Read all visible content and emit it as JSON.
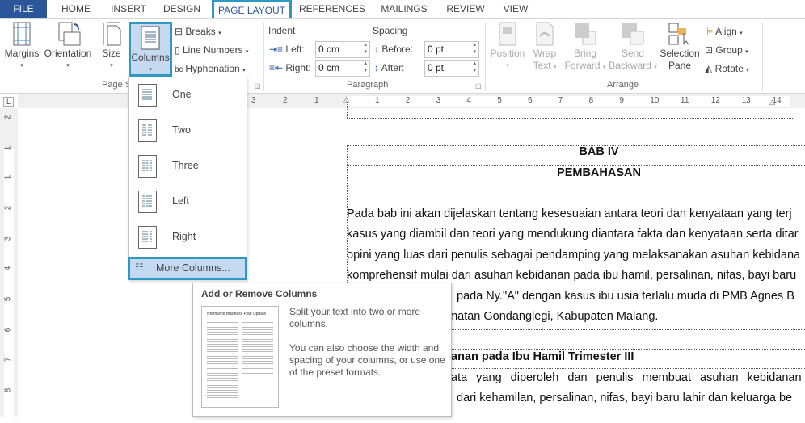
{
  "tabs": [
    {
      "label": "FILE"
    },
    {
      "label": "HOME"
    },
    {
      "label": "INSERT"
    },
    {
      "label": "DESIGN"
    },
    {
      "label": "PAGE LAYOUT",
      "active": true
    },
    {
      "label": "REFERENCES"
    },
    {
      "label": "MAILINGS"
    },
    {
      "label": "REVIEW"
    },
    {
      "label": "VIEW"
    }
  ],
  "ribbon": {
    "page_setup": {
      "group": "Page Setup",
      "margins": "Margins",
      "orientation": "Orientation",
      "size": "Size",
      "columns": "Columns",
      "breaks": "Breaks",
      "line_numbers": "Line Numbers",
      "hyphenation": "Hyphenation"
    },
    "paragraph": {
      "group": "Paragraph",
      "indent": "Indent",
      "spacing": "Spacing",
      "left_label": "Left:",
      "left_value": "0 cm",
      "right_label": "Right:",
      "right_value": "0 cm",
      "before_label": "Before:",
      "before_value": "0 pt",
      "after_label": "After:",
      "after_value": "0 pt"
    },
    "arrange": {
      "group": "Arrange",
      "position": "Position",
      "wrap1": "Wrap",
      "wrap2": "Text",
      "bring1": "Bring",
      "bring2": "Forward",
      "send1": "Send",
      "send2": "Backward",
      "sel1": "Selection",
      "sel2": "Pane",
      "align": "Align",
      "group_btn": "Group",
      "rotate": "Rotate"
    }
  },
  "columns_menu": {
    "items": [
      {
        "label": "One"
      },
      {
        "label": "Two"
      },
      {
        "label": "Three"
      },
      {
        "label": "Left"
      },
      {
        "label": "Right"
      }
    ],
    "more": "More Columns..."
  },
  "tooltip": {
    "title": "Add or Remove Columns",
    "p1": "Split your text into two or more columns.",
    "p2": "You can also choose the width and spacing of your columns, or use one of the preset formats.",
    "thumb_title": "Northwind Business Plan Update"
  },
  "ruler": {
    "left": [
      "3",
      "2",
      "1"
    ],
    "right": [
      "1",
      "2",
      "3",
      "4",
      "5",
      "6",
      "7",
      "8",
      "9",
      "10",
      "11",
      "12",
      "13",
      "14"
    ],
    "vertical": [
      "2",
      "1",
      "1",
      "2",
      "3",
      "4",
      "5",
      "6",
      "7",
      "8"
    ]
  },
  "document": {
    "heading1": "BAB IV",
    "heading2": "PEMBAHASAN",
    "lines": [
      "Pada bab ini akan dijelaskan tentang kesesuaian antara teori dan kenyataan yang terj",
      "kasus yang diambil dan teori yang mendukung diantara fakta dan kenyataan serta ditar",
      "opini yang luas dari penulis sebagai pendamping yang melaksanakan asuhan kebidana",
      "komprehensif mulai dari asuhan kebidanan pada ibu hamil, persalinan, nifas, bayi baru"
    ],
    "line5": "pada Ny.\"A\" dengan kasus ibu usia terlalu muda di PMB Agnes B",
    "line6": "amatan Gondanglegi, Kabupaten Malang.",
    "subheading": "anan pada Ibu Hamil Trimester III",
    "line8": "ata yang diperoleh dan penulis membuat asuhan kebidanan",
    "line9": "dari kehamilan, persalinan, nifas, bayi baru lahir dan keluarga be"
  },
  "colors": {
    "file_tab": "#2b579a",
    "highlight_border": "#2e9ac4",
    "highlight_fill": "#c5d9f1"
  }
}
